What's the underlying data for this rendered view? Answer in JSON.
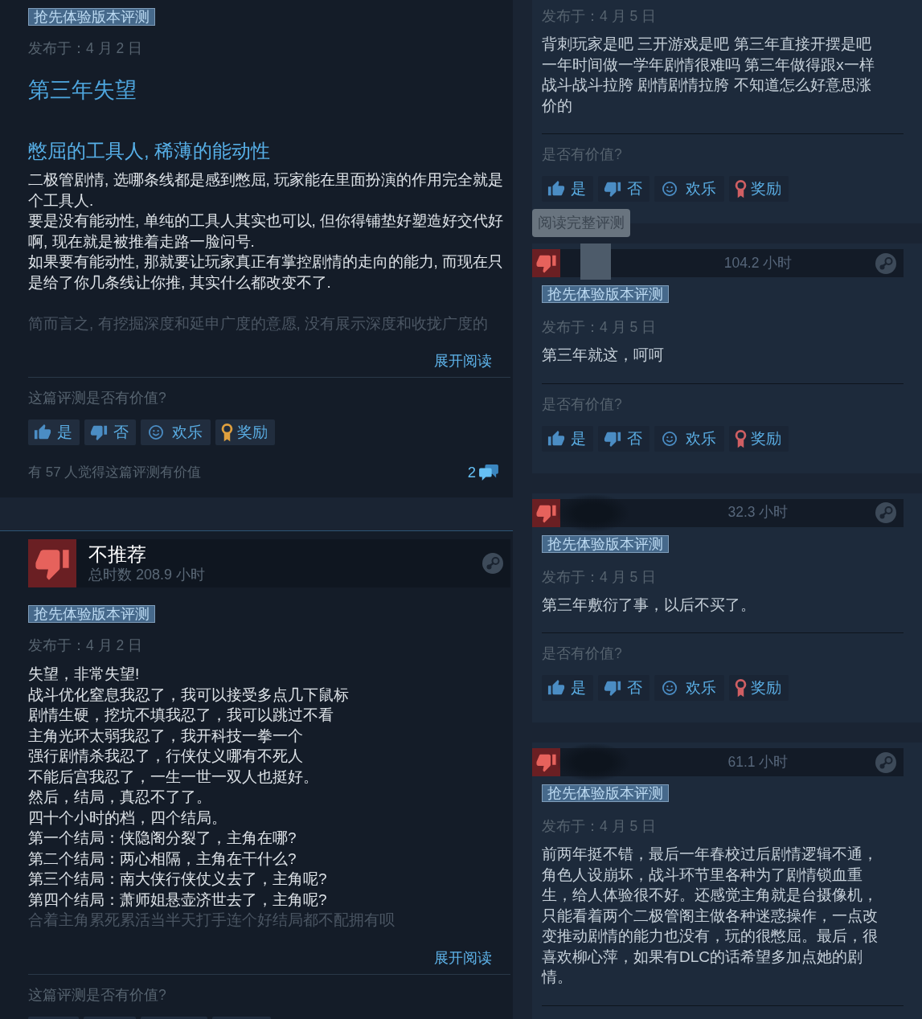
{
  "left_column": {
    "reviews": [
      {
        "tag": "抢先体验版本评测",
        "date": "发布于：4 月 2 日",
        "title": "第三年失望",
        "body": [
          {
            "kind": "heading",
            "text": "憋屈的工具人, 稀薄的能动性"
          },
          {
            "kind": "text",
            "text": "二极管剧情, 选哪条线都是感到憋屈, 玩家能在里面扮演的作用完全就是个工具人."
          },
          {
            "kind": "text",
            "text": "要是没有能动性, 单纯的工具人其实也可以, 但你得铺垫好塑造好交代好啊, 现在就是被推着走路一脸问号."
          },
          {
            "kind": "text",
            "text": "如果要有能动性, 那就要让玩家真正有掌控剧情的走向的能力, 而现在只是给了你几条线让你推, 其实什么都改变不了."
          },
          {
            "kind": "break"
          },
          {
            "kind": "faded",
            "text": "简而言之, 有挖掘深度和延申广度的意愿, 没有展示深度和收拢广度的"
          }
        ],
        "expand": "展开阅读",
        "prompt": "这篇评测是否有价值?",
        "votes": [
          {
            "kind": "up",
            "label": "是",
            "color": "#4b8dc4"
          },
          {
            "kind": "down",
            "label": "否",
            "color": "#4b8dc4"
          },
          {
            "kind": "funny",
            "label": "欢乐",
            "color": "#4b8dc4"
          },
          {
            "kind": "award",
            "label": "奖励",
            "color": "#e0a03e"
          }
        ],
        "helpful": "有 57 人觉得这篇评测有价值",
        "comments": "2"
      },
      {
        "header": {
          "recommended": false,
          "verdict": "不推荐",
          "hours": "总时数 208.9 小时"
        },
        "tag": "抢先体验版本评测",
        "date": "发布于：4 月 2 日",
        "body": [
          {
            "kind": "text",
            "text": "失望，非常失望!"
          },
          {
            "kind": "text",
            "text": "战斗优化窒息我忍了，我可以接受多点几下鼠标"
          },
          {
            "kind": "text",
            "text": "剧情生硬，挖坑不填我忍了，我可以跳过不看"
          },
          {
            "kind": "text",
            "text": "主角光环太弱我忍了，我开科技一拳一个"
          },
          {
            "kind": "text",
            "text": "强行剧情杀我忍了，行侠仗义哪有不死人"
          },
          {
            "kind": "text",
            "text": "不能后宫我忍了，一生一世一双人也挺好。"
          },
          {
            "kind": "text",
            "text": "然后，结局，真忍不了了。"
          },
          {
            "kind": "text",
            "text": "四十个小时的档，四个结局。"
          },
          {
            "kind": "text",
            "text": "第一个结局：侠隐阁分裂了，主角在哪?"
          },
          {
            "kind": "text",
            "text": "第二个结局：两心相隔，主角在干什么?"
          },
          {
            "kind": "text",
            "text": "第三个结局：南大侠行侠仗义去了，主角呢?"
          },
          {
            "kind": "text",
            "text": "第四个结局：萧师姐悬壶济世去了，主角呢?"
          },
          {
            "kind": "faded",
            "text": "合着主角累死累活当半天打手连个好结局都不配拥有呗"
          }
        ],
        "expand": "展开阅读",
        "prompt": "这篇评测是否有价值?",
        "votes_clipped": [
          {
            "kind": "up"
          },
          {
            "kind": "down"
          },
          {
            "kind": "funny"
          },
          {
            "kind": "award"
          }
        ]
      }
    ]
  },
  "right_column": {
    "reviews": [
      {
        "date": "发布于：4 月 5 日",
        "body": [
          {
            "kind": "text",
            "text": "背刺玩家是吧 三开游戏是吧 第三年直接开摆是吧一年时间做一学年剧情很难吗 第三年做得跟x一样战斗战斗拉胯 剧情剧情拉胯 不知道怎么好意思涨价的"
          }
        ],
        "prompt": "是否有价值?",
        "votes": [
          {
            "kind": "up",
            "label": "是",
            "color": "#4b8dc4"
          },
          {
            "kind": "down",
            "label": "否",
            "color": "#4b8dc4"
          },
          {
            "kind": "funny",
            "label": "欢乐",
            "color": "#4b8dc4"
          },
          {
            "kind": "award",
            "label": "奖励",
            "color": "#cf5f63"
          }
        ],
        "tooltip": "阅读完整评测"
      },
      {
        "header": {
          "recommended": false,
          "name_mask": {
            "kind": "light"
          },
          "hours": "104.2 小时"
        },
        "tag": "抢先体验版本评测",
        "date": "发布于：4 月 5 日",
        "body": [
          {
            "kind": "text",
            "text": "第三年就这，呵呵"
          }
        ],
        "prompt": "是否有价值?",
        "votes": [
          {
            "kind": "up",
            "label": "是",
            "color": "#4b8dc4"
          },
          {
            "kind": "down",
            "label": "否",
            "color": "#4b8dc4"
          },
          {
            "kind": "funny",
            "label": "欢乐",
            "color": "#4b8dc4"
          },
          {
            "kind": "award",
            "label": "奖励",
            "color": "#cf5f63"
          }
        ]
      },
      {
        "header": {
          "recommended": false,
          "name_mask": {
            "kind": "dark"
          },
          "hours": "32.3 小时"
        },
        "tag": "抢先体验版本评测",
        "date": "发布于：4 月 5 日",
        "body": [
          {
            "kind": "text",
            "text": "第三年敷衍了事，以后不买了。"
          }
        ],
        "prompt": "是否有价值?",
        "votes": [
          {
            "kind": "up",
            "label": "是",
            "color": "#4b8dc4"
          },
          {
            "kind": "down",
            "label": "否",
            "color": "#4b8dc4"
          },
          {
            "kind": "funny",
            "label": "欢乐",
            "color": "#4b8dc4"
          },
          {
            "kind": "award",
            "label": "奖励",
            "color": "#cf5f63"
          }
        ]
      },
      {
        "header": {
          "recommended": false,
          "name_mask": {
            "kind": "dark"
          },
          "hours": "61.1 小时"
        },
        "tag": "抢先体验版本评测",
        "date": "发布于：4 月 5 日",
        "body": [
          {
            "kind": "text",
            "text": "前两年挺不错，最后一年春校过后剧情逻辑不通，角色人设崩坏，战斗环节里各种为了剧情锁血重生，给人体验很不好。还感觉主角就是台摄像机，只能看着两个二极管阁主做各种迷惑操作，一点改变推动剧情的能力也没有，玩的很憋屈。最后，很喜欢柳心萍，如果有DLC的话希望多加点她的剧情。"
          }
        ]
      }
    ]
  }
}
